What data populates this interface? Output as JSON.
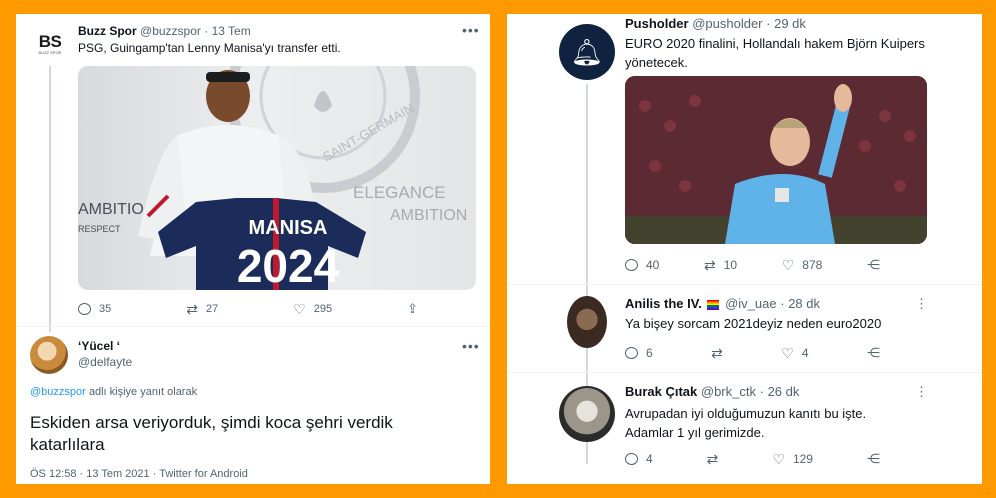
{
  "left_tweet": {
    "avatar_text": "BS",
    "avatar_sub": "BUZZ SPOR",
    "author_name": "Buzz Spor",
    "author_handle": "@buzzspor",
    "time": "13 Tem",
    "text": "PSG, Guingamp'tan Lenny Manisa'yı transfer etti.",
    "image": {
      "shirt_name": "MANISA",
      "shirt_number": "2024",
      "bg_words": [
        "AMBITIO",
        "RESPECT",
        "ELEGANCE",
        "AMBITION",
        "SAINT-GERMAIN"
      ]
    },
    "actions": {
      "replies": "35",
      "retweets": "27",
      "likes": "295"
    }
  },
  "reply_tweet": {
    "author_name": "ʻYücel ʻ",
    "author_handle": "@delfayte",
    "reply_to_handle": "@buzzspor",
    "reply_to_suffix": "adlı kişiye yanıt olarak",
    "text": "Eskiden arsa veriyorduk, şimdi koca şehri verdik katarlılara",
    "meta": "ÖS 12:58 · 13 Tem 2021 · Twitter for Android"
  },
  "right_main": {
    "author_name": "Pusholder",
    "author_handle": "@pusholder",
    "time": "29 dk",
    "text": "EURO 2020 finalini, Hollandalı hakem Björn Kuipers yönetecek.",
    "actions": {
      "replies": "40",
      "retweets": "10",
      "likes": "878"
    }
  },
  "right_reply1": {
    "author_name": "Anilis the IV.",
    "author_handle": "@iv_uae",
    "time": "28 dk",
    "text": "Ya bişey sorcam 2021deyiz neden euro2020",
    "actions": {
      "replies": "6",
      "likes": "4"
    }
  },
  "right_reply2": {
    "author_name": "Burak Çıtak",
    "author_handle": "@brk_ctk",
    "time": "26 dk",
    "text": "Avrupadan iyi olduğumuzun kanıtı bu işte. Adamlar 1 yıl gerimizde.",
    "actions": {
      "replies": "4",
      "likes": "129"
    }
  },
  "colors": {
    "frame": "#ff9900",
    "link": "#1d9bf0",
    "muted": "#536471"
  }
}
